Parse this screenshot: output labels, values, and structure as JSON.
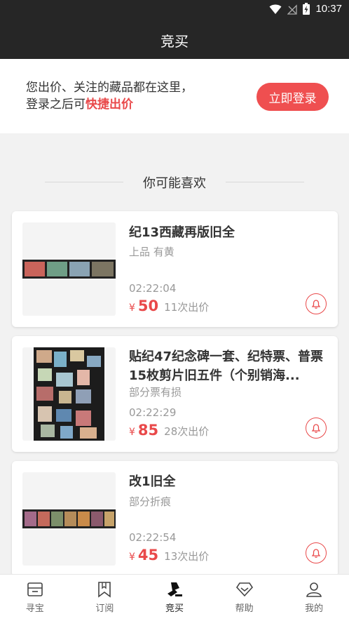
{
  "status_bar": {
    "time": "10:37"
  },
  "header": {
    "title": "竞买"
  },
  "login_banner": {
    "line1": "您出价、关注的藏品都在这里，",
    "line2_prefix": "登录之后可",
    "line2_highlight": "快捷出价",
    "button": "立即登录"
  },
  "section": {
    "title": "你可能喜欢"
  },
  "items": [
    {
      "title": "纪13西藏再版旧全",
      "desc": "上品 有黄",
      "time": "02:22:04",
      "currency": "¥",
      "price": "50",
      "bids": "11次出价"
    },
    {
      "title": "贴纪47纪念碑一套、纪特票、普票15枚剪片旧五件（个别销海...",
      "desc": "部分票有损",
      "time": "02:22:29",
      "currency": "¥",
      "price": "85",
      "bids": "28次出价"
    },
    {
      "title": "改1旧全",
      "desc": "部分折痕",
      "time": "02:22:54",
      "currency": "¥",
      "price": "45",
      "bids": "13次出价"
    }
  ],
  "tab_bar": {
    "tabs": [
      {
        "label": "寻宝",
        "icon": "box-icon"
      },
      {
        "label": "订阅",
        "icon": "bookmark-icon"
      },
      {
        "label": "竞买",
        "icon": "gavel-icon",
        "active": true
      },
      {
        "label": "帮助",
        "icon": "diamond-icon"
      },
      {
        "label": "我的",
        "icon": "user-icon"
      }
    ]
  },
  "colors": {
    "accent": "#ef4f50",
    "header_bg": "#262626",
    "page_bg": "#f2f2f2"
  }
}
